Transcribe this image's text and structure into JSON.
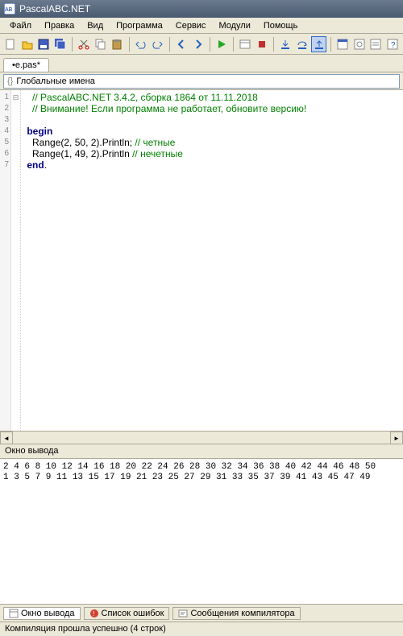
{
  "titlebar": {
    "title": "PascalABC.NET"
  },
  "menu": [
    "Файл",
    "Правка",
    "Вид",
    "Программа",
    "Сервис",
    "Модули",
    "Помощь"
  ],
  "tab": {
    "label": "•e.pas*"
  },
  "dropdown": {
    "prefix": "{}",
    "label": "Глобальные имена"
  },
  "gutter": [
    "1",
    "2",
    "3",
    "4",
    "5",
    "6",
    "7"
  ],
  "fold": [
    "",
    "",
    "",
    "⊟",
    "",
    "",
    ""
  ],
  "code": {
    "l1": {
      "comment": "// PascalABC.NET 3.4.2, сборка 1864 от 11.11.2018"
    },
    "l2": {
      "comment": "// Внимание! Если программа не работает, обновите версию!"
    },
    "l4": {
      "kw": "begin"
    },
    "l5": {
      "txt": "Range(2, 50, 2).Println; ",
      "cmt": "// четные"
    },
    "l6": {
      "txt": "Range(1, 49, 2).Println ",
      "cmt": "// нечетные"
    },
    "l7": {
      "kw": "end",
      "dot": "."
    }
  },
  "output_title": "Окно вывода",
  "output": "2 4 6 8 10 12 14 16 18 20 22 24 26 28 30 32 34 36 38 40 42 44 46 48 50\n1 3 5 7 9 11 13 15 17 19 21 23 25 27 29 31 33 35 37 39 41 43 45 47 49",
  "bottom_tabs": [
    "Окно вывода",
    "Список ошибок",
    "Сообщения компилятора"
  ],
  "status": "Компиляция прошла успешно (4 строк)"
}
